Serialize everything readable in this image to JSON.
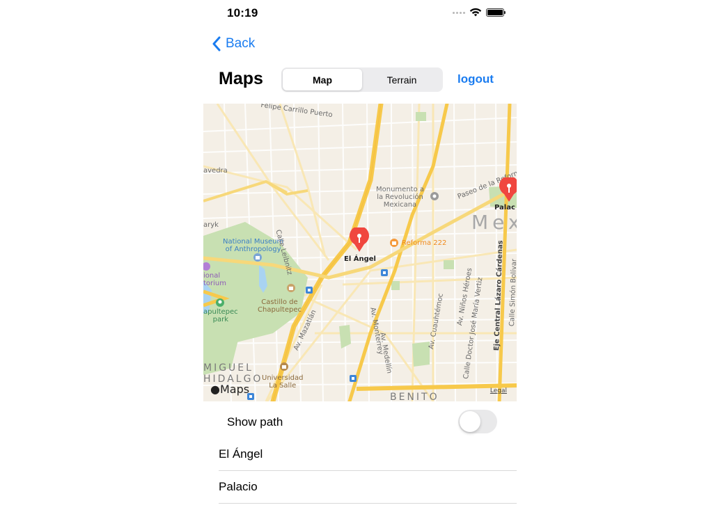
{
  "status_bar": {
    "time": "10:19",
    "icons": [
      "cellular-signal-icon",
      "wifi-icon",
      "battery-icon"
    ]
  },
  "nav": {
    "back_label": "Back",
    "title": "Maps",
    "segments": [
      "Map",
      "Terrain"
    ],
    "selected_segment": "Map",
    "logout_label": "logout"
  },
  "map": {
    "pins": [
      {
        "label": "El Ángel",
        "color": "#f0473f"
      },
      {
        "label": "Palac",
        "color": "#f0473f"
      }
    ],
    "labels": {
      "felipe": "Felipe Carrillo Puerto",
      "avedra": "avedra",
      "aryk": "aryk",
      "reforma_paseo": "Paseo de la Reforma",
      "monumento": "Monumento a\nla Revolución\nMexicana",
      "mex": "Mex",
      "museum": "National Museum\nof Anthropology",
      "leibnitz": "Calle Leibnitz",
      "reforma222": "Reforma 222",
      "auditorio": "ional\ntorium",
      "castillo": "Castillo de\nChapultepec",
      "chapultepec_park": "apultepec\npark",
      "mazatlan": "Av. Mazatlán",
      "monterrey": "Av. Monterrey",
      "medellin": "Av. Medellín",
      "cuauhtemoc": "Av. Cuauhtémoc",
      "ninos_heroes": "Av. Niños Héroes",
      "jose_maria_vertiz": "Calle Doctor José María Vertiz",
      "lazaro_cardenas": "Eje Central Lázaro Cárdenas",
      "simon_bolivar": "Calle Simón Bolívar",
      "miguel_hidalgo": "MIGUEL\nHIDALGO",
      "universidad": "Universidad\nLa Salle",
      "benito": "BENITO",
      "watermark": "Maps",
      "legal": "Legal"
    },
    "colors": {
      "land": "#f4efe6",
      "park": "#c8e0b2",
      "major_road": "#f7c94b",
      "minor_road": "#ffffff",
      "water": "#a9d3f2"
    }
  },
  "options": {
    "show_path_label": "Show path",
    "show_path_on": false
  },
  "places": [
    "El Ángel",
    "Palacio"
  ]
}
